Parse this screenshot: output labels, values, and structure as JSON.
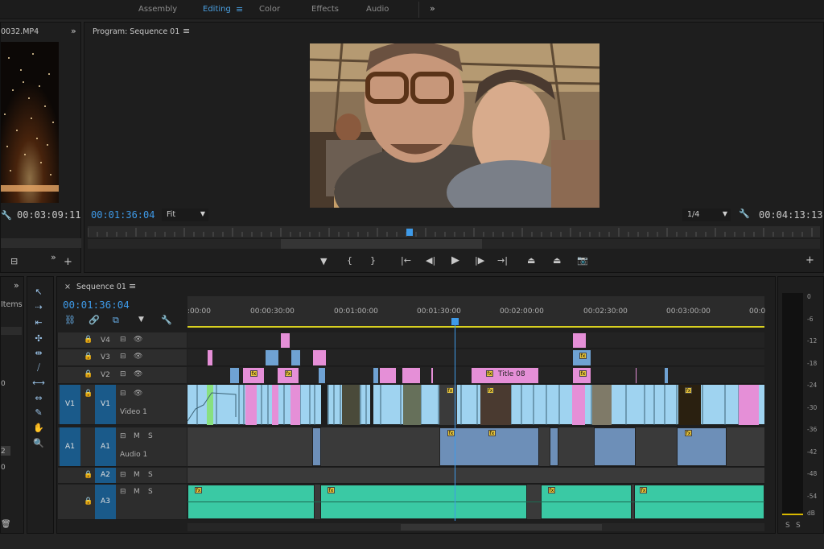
{
  "workspaces": [
    "Assembly",
    "Editing",
    "Color",
    "Effects",
    "Audio"
  ],
  "active_workspace": "Editing",
  "source": {
    "clip_name": "0032.MP4",
    "timecode": "00:03:09:11"
  },
  "program": {
    "title": "Program: Sequence 01",
    "timecode": "00:01:36:04",
    "fit": "Fit",
    "resolution": "1/4",
    "duration": "00:04:13:13"
  },
  "project": {
    "items_label": "Items",
    "values": [
      "0",
      "2",
      "0"
    ]
  },
  "timeline": {
    "sequence_name": "Sequence 01",
    "timecode": "00:01:36:04",
    "ruler": [
      ":00:00",
      "00:00:30:00",
      "00:01:00:00",
      "00:01:30:00",
      "00:02:00:00",
      "00:02:30:00",
      "00:03:00:00",
      "00:0"
    ],
    "tracks": {
      "v4": "V4",
      "v3": "V3",
      "v2": "V2",
      "v1": "V1",
      "v1_src": "V1",
      "video1": "Video 1",
      "a1": "A1",
      "a1_src": "A1",
      "audio1": "Audio 1",
      "a2": "A2",
      "a3": "A3"
    },
    "title_clip": "Title 08",
    "m": "M",
    "s": "S",
    "fx": "fx"
  },
  "meter": {
    "labels": [
      "0",
      "-6",
      "-12",
      "-18",
      "-24",
      "-30",
      "-36",
      "-42",
      "-48",
      "-54"
    ],
    "db": "dB",
    "s1": "S",
    "s2": "S"
  },
  "colors": {
    "accent": "#3e9ae8",
    "video_clip": "#9fd3f0",
    "title_clip": "#e58fd7",
    "audio_clip": "#6d8fb8",
    "audio_green": "#3ac9a4"
  }
}
